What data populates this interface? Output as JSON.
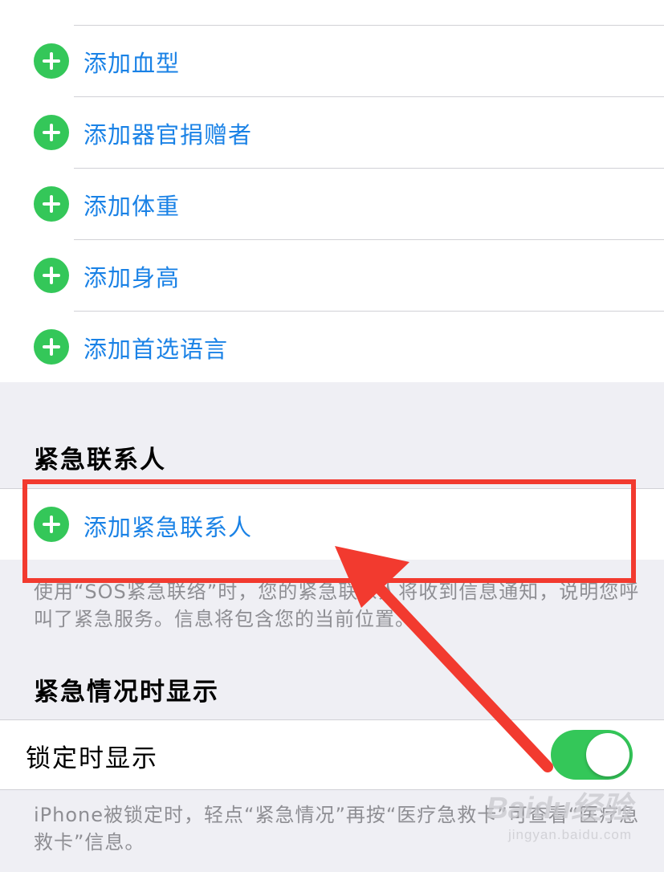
{
  "medical_id_list": {
    "items": [
      {
        "label": "添加血型"
      },
      {
        "label": "添加器官捐赠者"
      },
      {
        "label": "添加体重"
      },
      {
        "label": "添加身高"
      },
      {
        "label": "添加首选语言"
      }
    ]
  },
  "emergency_contacts": {
    "header": "紧急联系人",
    "add_label": "添加紧急联系人",
    "footer": "使用“SOS紧急联络”时，您的紧急联系人将收到信息通知，说明您呼叫了紧急服务。信息将包含您的当前位置。"
  },
  "show_when_locked": {
    "header": "紧急情况时显示",
    "label": "锁定时显示",
    "toggle_on": true,
    "footer": "iPhone被锁定时，轻点“紧急情况”再按“医疗急救卡”可查看“医疗急救卡”信息。"
  },
  "watermark": {
    "brand": "Baidu经验",
    "url": "jingyan.baidu.com"
  },
  "colors": {
    "accent_link": "#1a82e6",
    "plus_green": "#34c759",
    "highlight_red": "#f23a2f",
    "background": "#efeff4"
  },
  "icons": {
    "add": "plus-circle-icon",
    "annotation": "red-arrow-icon"
  }
}
